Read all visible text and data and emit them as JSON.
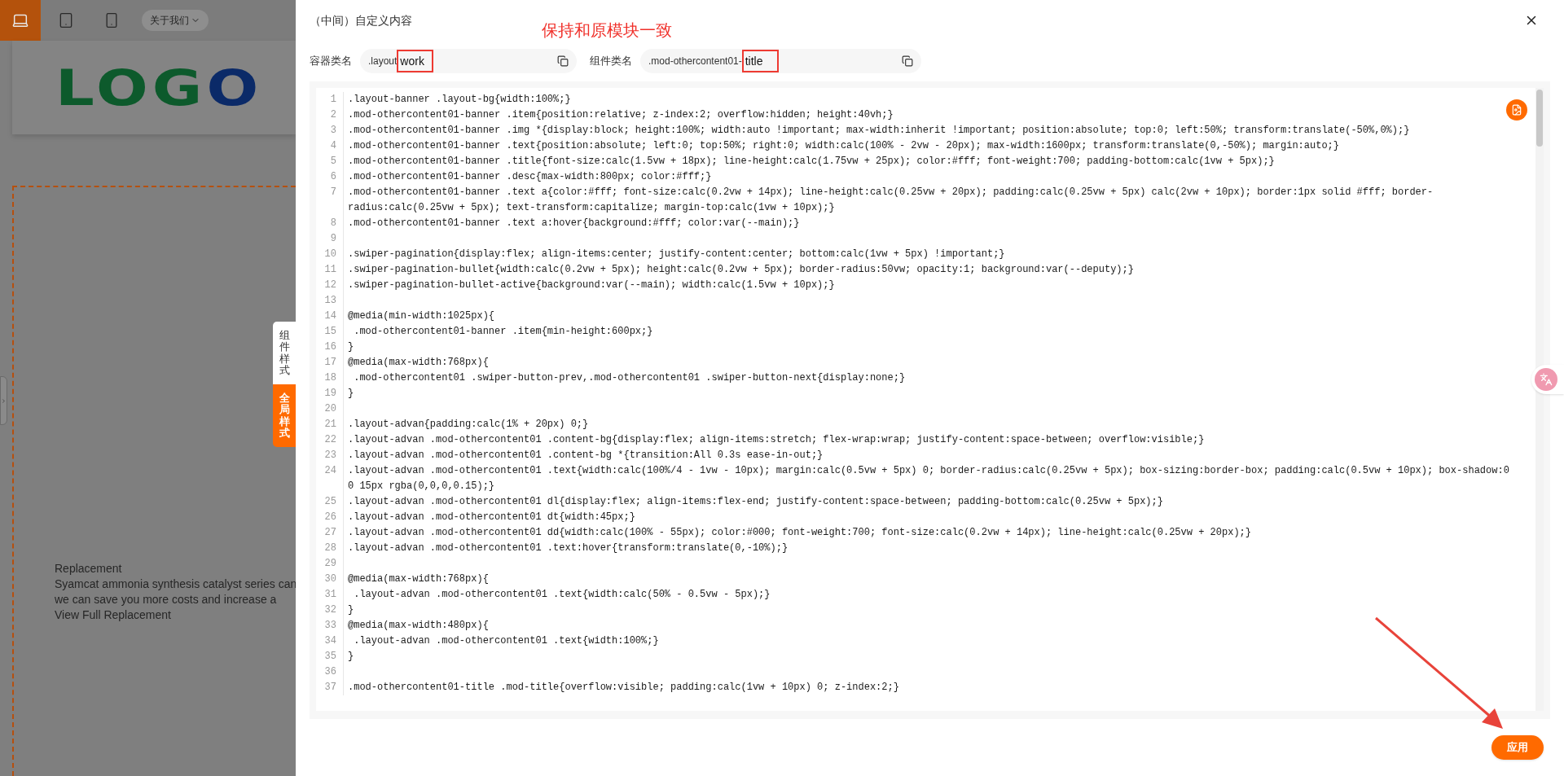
{
  "preview": {
    "devices": [
      {
        "kind": "laptop",
        "selected": true
      },
      {
        "kind": "tablet",
        "selected": false
      },
      {
        "kind": "phone",
        "selected": false
      }
    ],
    "menu": "关于我们",
    "logo": [
      {
        "text": "LOG",
        "color": "#0d5a2c"
      },
      {
        "text": "O",
        "color": "#0b2a68"
      }
    ],
    "banner_text": [
      "Replacement",
      "Syamcat ammonia synthesis catalyst series can",
      "we can save you more costs and increase a",
      "View Full Replacement"
    ],
    "style_tabs": [
      {
        "label": "组件样式",
        "selected": false
      },
      {
        "label": "全局样式",
        "selected": true
      }
    ]
  },
  "drawer": {
    "title": "（中间）自定义内容",
    "annotation": "保持和原模块一致",
    "fields": [
      {
        "label": "容器类名",
        "prefix": ".layout",
        "value": "work",
        "highlighted": true
      },
      {
        "label": "组件类名",
        "prefix": ".mod-othercontent01-",
        "value": "title",
        "highlighted": true
      }
    ],
    "code_lines": [
      {
        "n": "1",
        "code": ".layout-banner .layout-bg{width:100%;}"
      },
      {
        "n": "2",
        "code": ".mod-othercontent01-banner .item{position:relative; z-index:2; overflow:hidden; height:40vh;}"
      },
      {
        "n": "3",
        "code": ".mod-othercontent01-banner .img *{display:block; height:100%; width:auto !important; max-width:inherit !important; position:absolute; top:0; left:50%; transform:translate(-50%,0%);}"
      },
      {
        "n": "4",
        "code": ".mod-othercontent01-banner .text{position:absolute; left:0; top:50%; right:0; width:calc(100% - 2vw - 20px); max-width:1600px; transform:translate(0,-50%); margin:auto;}"
      },
      {
        "n": "5",
        "code": ".mod-othercontent01-banner .title{font-size:calc(1.5vw + 18px); line-height:calc(1.75vw + 25px); color:#fff; font-weight:700; padding-bottom:calc(1vw + 5px);}"
      },
      {
        "n": "6",
        "code": ".mod-othercontent01-banner .desc{max-width:800px; color:#fff;}"
      },
      {
        "n": "7",
        "code": ".mod-othercontent01-banner .text a{color:#fff; font-size:calc(0.2vw + 14px); line-height:calc(0.25vw + 20px); padding:calc(0.25vw + 5px) calc(2vw + 10px); border:1px solid #fff; border-radius:calc(0.25vw + 5px); text-transform:capitalize; margin-top:calc(1vw + 10px);}"
      },
      {
        "n": "8",
        "code": ".mod-othercontent01-banner .text a:hover{background:#fff; color:var(--main);}"
      },
      {
        "n": "9"
      },
      {
        "n": "10",
        "code": ".swiper-pagination{display:flex; align-items:center; justify-content:center; bottom:calc(1vw + 5px) !important;}"
      },
      {
        "n": "11",
        "code": ".swiper-pagination-bullet{width:calc(0.2vw + 5px); height:calc(0.2vw + 5px); border-radius:50vw; opacity:1; background:var(--deputy);}"
      },
      {
        "n": "12",
        "code": ".swiper-pagination-bullet-active{background:var(--main); width:calc(1.5vw + 10px);}"
      },
      {
        "n": "13"
      },
      {
        "n": "14",
        "code": "@media(min-width:1025px){"
      },
      {
        "n": "15",
        "code": " .mod-othercontent01-banner .item{min-height:600px;}"
      },
      {
        "n": "16",
        "code": "}"
      },
      {
        "n": "17",
        "code": "@media(max-width:768px){"
      },
      {
        "n": "18",
        "code": " .mod-othercontent01 .swiper-button-prev,.mod-othercontent01 .swiper-button-next{display:none;}"
      },
      {
        "n": "19",
        "code": "}"
      },
      {
        "n": "20"
      },
      {
        "n": "21",
        "code": ".layout-advan{padding:calc(1% + 20px) 0;}"
      },
      {
        "n": "22",
        "code": ".layout-advan .mod-othercontent01 .content-bg{display:flex; align-items:stretch; flex-wrap:wrap; justify-content:space-between; overflow:visible;}"
      },
      {
        "n": "23",
        "code": ".layout-advan .mod-othercontent01 .content-bg *{transition:All 0.3s ease-in-out;}"
      },
      {
        "n": "24",
        "code": ".layout-advan .mod-othercontent01 .text{width:calc(100%/4 - 1vw - 10px); margin:calc(0.5vw + 5px) 0; border-radius:calc(0.25vw + 5px); box-sizing:border-box; padding:calc(0.5vw + 10px); box-shadow:0 0 15px rgba(0,0,0,0.15);}"
      },
      {
        "n": "25",
        "code": ".layout-advan .mod-othercontent01 dl{display:flex; align-items:flex-end; justify-content:space-between; padding-bottom:calc(0.25vw + 5px);}"
      },
      {
        "n": "26",
        "code": ".layout-advan .mod-othercontent01 dt{width:45px;}"
      },
      {
        "n": "27",
        "code": ".layout-advan .mod-othercontent01 dd{width:calc(100% - 55px); color:#000; font-weight:700; font-size:calc(0.2vw + 14px); line-height:calc(0.25vw + 20px);}"
      },
      {
        "n": "28",
        "code": ".layout-advan .mod-othercontent01 .text:hover{transform:translate(0,-10%);}"
      },
      {
        "n": "29"
      },
      {
        "n": "30",
        "code": "@media(max-width:768px){"
      },
      {
        "n": "31",
        "code": " .layout-advan .mod-othercontent01 .text{width:calc(50% - 0.5vw - 5px);}"
      },
      {
        "n": "32",
        "code": "}"
      },
      {
        "n": "33",
        "code": "@media(max-width:480px){"
      },
      {
        "n": "34",
        "code": " .layout-advan .mod-othercontent01 .text{width:100%;}"
      },
      {
        "n": "35",
        "code": "}"
      },
      {
        "n": "36"
      },
      {
        "n": "37",
        "code": ".mod-othercontent01-title .mod-title{overflow:visible; padding:calc(1vw + 10px) 0; z-index:2;}"
      }
    ],
    "apply_button": "应用"
  }
}
